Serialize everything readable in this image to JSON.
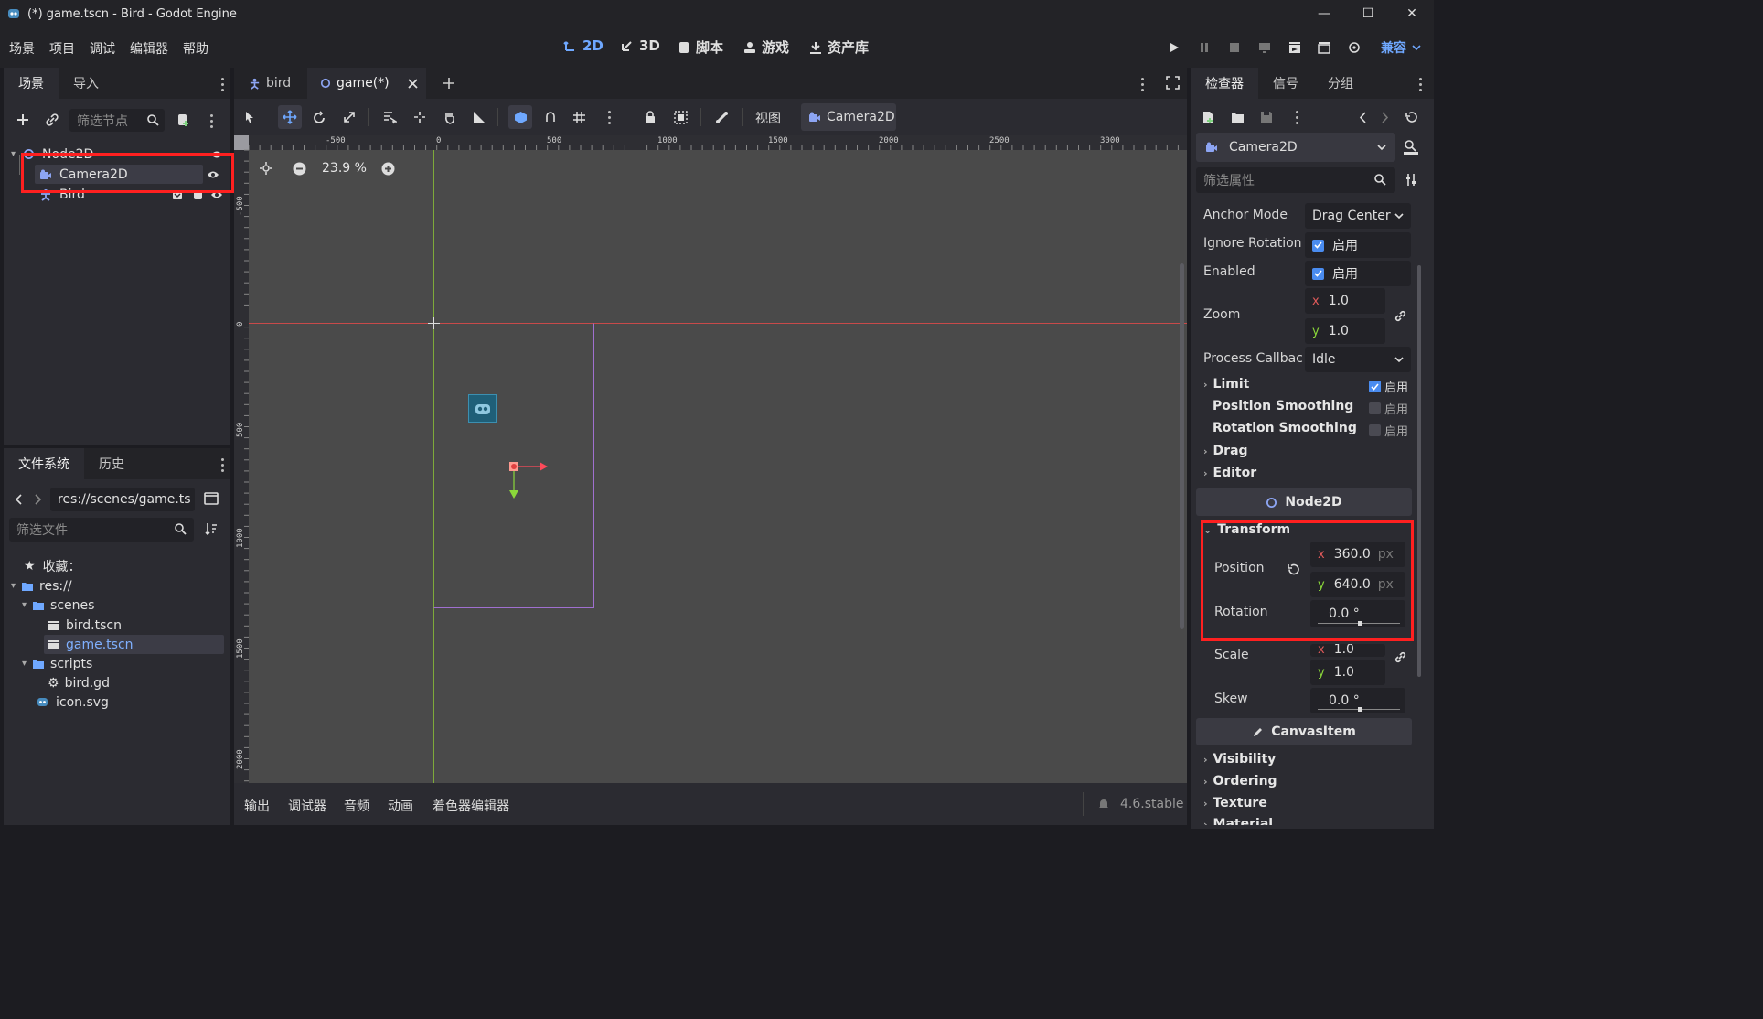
{
  "window": {
    "title": "(*) game.tscn - Bird - Godot Engine"
  },
  "menu": [
    "场景",
    "项目",
    "调试",
    "编辑器",
    "帮助"
  ],
  "workspaces": {
    "w2d": "2D",
    "w3d": "3D",
    "script": "脚本",
    "game": "游戏",
    "assetlib": "资产库"
  },
  "renderer": "兼容",
  "scene_panel": {
    "tabs": [
      "场景",
      "导入"
    ],
    "filter_placeholder": "筛选节点",
    "nodes": [
      "Node2D",
      "Camera2D",
      "Bird"
    ]
  },
  "filesystem": {
    "tabs": [
      "文件系统",
      "历史"
    ],
    "path": "res://scenes/game.ts",
    "filter_placeholder": "筛选文件",
    "favorites": "收藏：",
    "root": "res://",
    "scenes_folder": "scenes",
    "bird_tscn": "bird.tscn",
    "game_tscn": "game.tscn",
    "scripts_folder": "scripts",
    "bird_gd": "bird.gd",
    "icon_svg": "icon.svg"
  },
  "editor_tabs": [
    "bird",
    "game(*)"
  ],
  "toolbar": {
    "view": "视图",
    "camera": "Camera2D"
  },
  "viewport": {
    "zoom": "23.9 %",
    "ruler_h": [
      "-500",
      "0",
      "500",
      "1000",
      "1500",
      "2000",
      "2500",
      "3000"
    ],
    "ruler_v": [
      "-500",
      "0",
      "500",
      "1000",
      "1500",
      "2000"
    ]
  },
  "bottom_tabs": [
    "输出",
    "调试器",
    "音频",
    "动画",
    "着色器编辑器"
  ],
  "version": "4.6.stable",
  "inspector": {
    "tabs": [
      "检查器",
      "信号",
      "分组"
    ],
    "object": "Camera2D",
    "filter_placeholder": "筛选属性",
    "enable_label": "启用",
    "anchor_mode": {
      "label": "Anchor Mode",
      "value": "Drag Center"
    },
    "ignore_rotation": {
      "label": "Ignore Rotation",
      "checked": true
    },
    "enabled": {
      "label": "Enabled",
      "checked": true
    },
    "zoom": {
      "label": "Zoom",
      "x": "1.0",
      "y": "1.0"
    },
    "process_callback": {
      "label": "Process Callbac",
      "value": "Idle"
    },
    "limit": {
      "label": "Limit",
      "checked": true
    },
    "position_smoothing": {
      "label": "Position Smoothing",
      "checked": false
    },
    "rotation_smoothing": {
      "label": "Rotation Smoothing",
      "checked": false
    },
    "drag": "Drag",
    "editor": "Editor",
    "node2d_header": "Node2D",
    "transform": "Transform",
    "position": {
      "label": "Position",
      "x": "360.0",
      "y": "640.0",
      "unit": "px"
    },
    "rotation": {
      "label": "Rotation",
      "value": "0.0 °"
    },
    "scale": {
      "label": "Scale",
      "x": "1.0",
      "y": "1.0"
    },
    "skew": {
      "label": "Skew",
      "value": "0.0 °"
    },
    "canvasitem_header": "CanvasItem",
    "visibility": "Visibility",
    "ordering": "Ordering",
    "texture": "Texture",
    "material": "Material"
  },
  "axis": {
    "x": "x",
    "y": "y"
  },
  "colors": {
    "accent": "#6fa8ff",
    "highlight": "#ff2020",
    "viewport_bg": "#4a4a4a"
  }
}
